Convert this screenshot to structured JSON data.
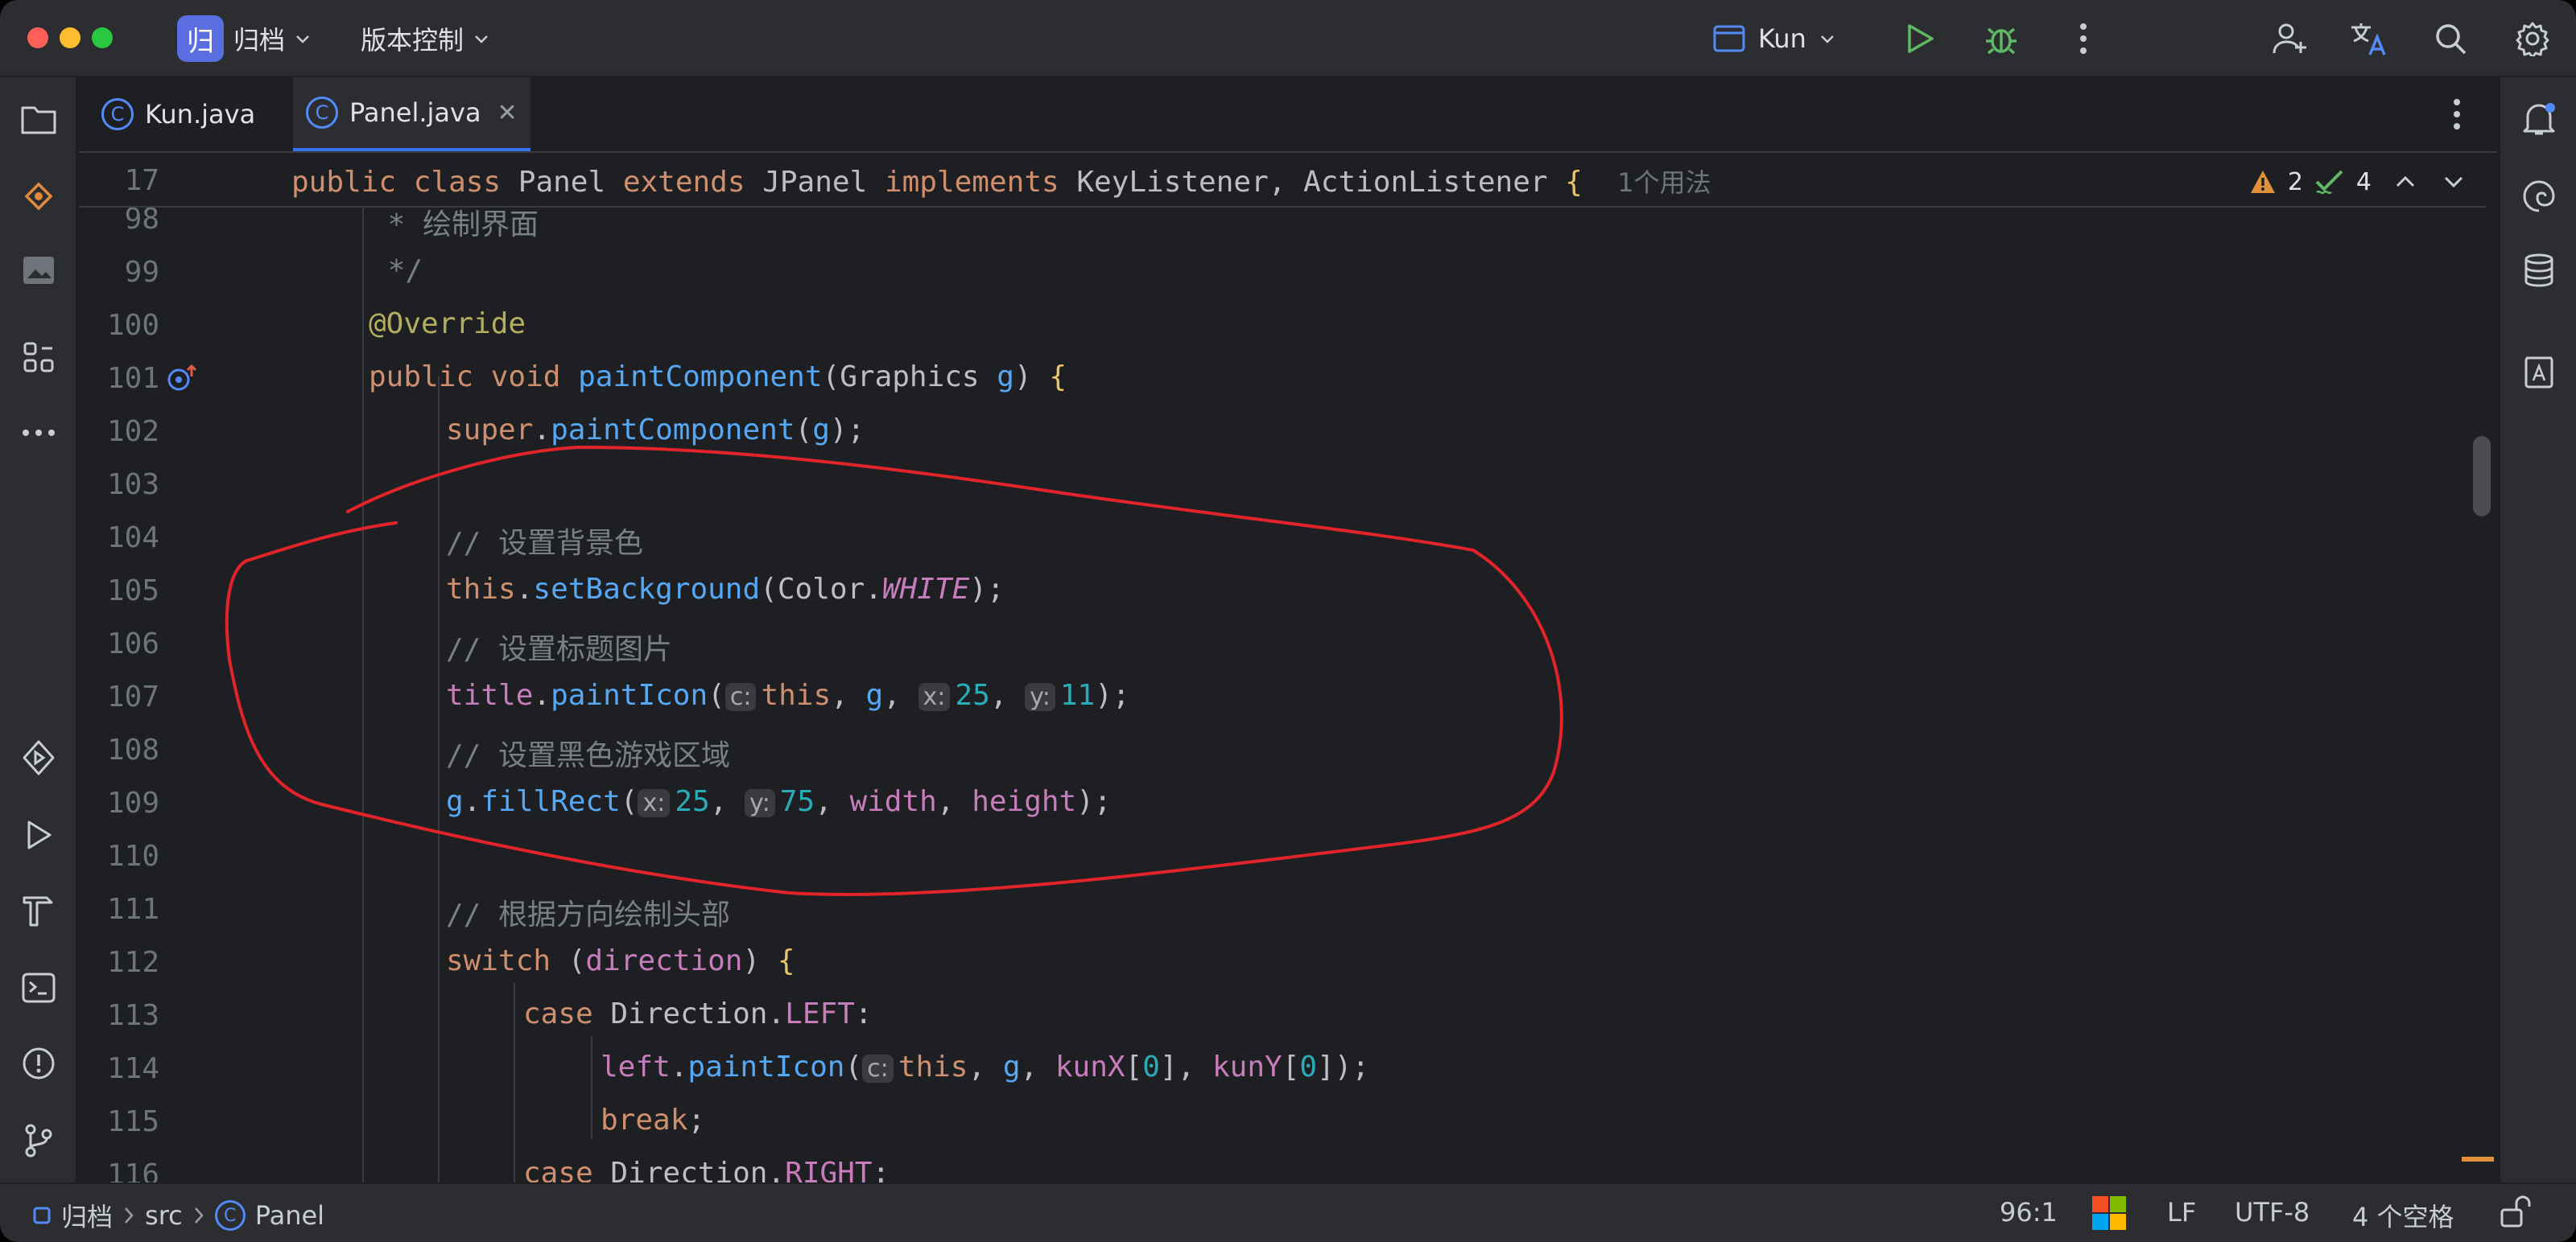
{
  "titlebar": {
    "project_badge": "归",
    "project_name": "归档",
    "vcs_menu": "版本控制",
    "run_config": "Kun"
  },
  "tabs": [
    {
      "label": "Kun.java",
      "active": false
    },
    {
      "label": "Panel.java",
      "active": true
    }
  ],
  "sticky": {
    "line": "17",
    "usage": "1个用法"
  },
  "inspections": {
    "warnings": "2",
    "weak_warnings": "4"
  },
  "lines": {
    "n98": "98",
    "n99": "99",
    "n100": "100",
    "n101": "101",
    "n102": "102",
    "n103": "103",
    "n104": "104",
    "n105": "105",
    "n106": "106",
    "n107": "107",
    "n108": "108",
    "n109": "109",
    "n110": "110",
    "n111": "111",
    "n112": "112",
    "n113": "113",
    "n114": "114",
    "n115": "115",
    "n116": "116",
    "c98": " * 绘制界面",
    "c99": " */",
    "c100": "@Override",
    "c104": "// 设置背景色",
    "c106": "// 设置标题图片",
    "c108": "// 设置黑色游戏区域",
    "c111": "// 根据方向绘制头部"
  },
  "hints": {
    "c": "c:",
    "x": "x:",
    "y": "y:"
  },
  "statusbar": {
    "breadcrumb": [
      "归档",
      "src",
      "Panel"
    ],
    "position": "96:1",
    "line_sep": "LF",
    "encoding": "UTF-8",
    "indent": "4 个空格"
  },
  "colors": {
    "accent": "#3574f0",
    "annotation": "#e0242a",
    "run_green": "#5fb865"
  }
}
